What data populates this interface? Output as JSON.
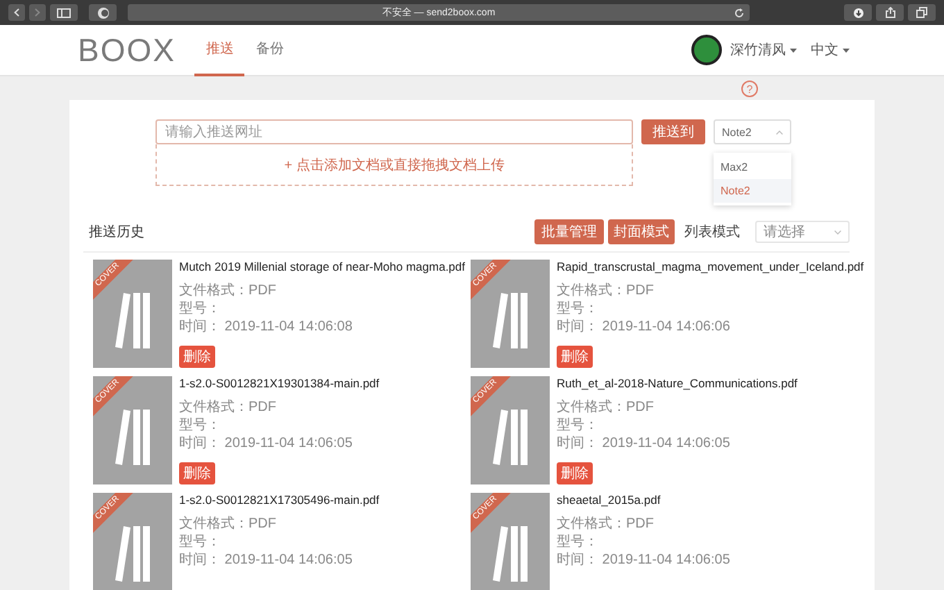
{
  "browser": {
    "address": "不安全 — send2boox.com"
  },
  "header": {
    "logo": "BOOX",
    "tabs": [
      {
        "label": "推送",
        "selected": true
      },
      {
        "label": "备份",
        "selected": false
      }
    ],
    "user": "深竹清风",
    "language": "中文"
  },
  "help": "?",
  "push": {
    "placeholder": "请输入推送网址",
    "button": "推送到",
    "device": "Note2",
    "options": [
      {
        "label": "Max2",
        "selected": false
      },
      {
        "label": "Note2",
        "selected": true
      }
    ],
    "upload": "+ 点击添加文档或直接拖拽文档上传"
  },
  "history": {
    "title": "推送历史",
    "batch": "批量管理",
    "modes": [
      {
        "label": "封面模式",
        "selected": true
      },
      {
        "label": "列表模式",
        "selected": false
      }
    ],
    "sort_placeholder": "请选择",
    "items": [
      {
        "cover": "COVER",
        "name": "Mutch 2019 Millenial storage of near-Moho magma.pdf",
        "format_label": "文件格式：",
        "format": "PDF",
        "model_label": "型号：",
        "time_label": "时间：",
        "time": "2019-11-04 14:06:08",
        "delete": "删除"
      },
      {
        "cover": "COVER",
        "name": "Rapid_transcrustal_magma_movement_under_Iceland.pdf",
        "format_label": "文件格式：",
        "format": "PDF",
        "model_label": "型号：",
        "time_label": "时间：",
        "time": "2019-11-04 14:06:06",
        "delete": "删除"
      },
      {
        "cover": "COVER",
        "name": "1-s2.0-S0012821X19301384-main.pdf",
        "format_label": "文件格式：",
        "format": "PDF",
        "model_label": "型号：",
        "time_label": "时间：",
        "time": "2019-11-04 14:06:05",
        "delete": "删除"
      },
      {
        "cover": "COVER",
        "name": "Ruth_et_al-2018-Nature_Communications.pdf",
        "format_label": "文件格式：",
        "format": "PDF",
        "model_label": "型号：",
        "time_label": "时间：",
        "time": "2019-11-04 14:06:05",
        "delete": "删除"
      },
      {
        "cover": "COVER",
        "name": "1-s2.0-S0012821X17305496-main.pdf",
        "format_label": "文件格式：",
        "format": "PDF",
        "model_label": "型号：",
        "time_label": "时间：",
        "time": "2019-11-04 14:06:05"
      },
      {
        "cover": "COVER",
        "name": "sheaetal_2015a.pdf",
        "format_label": "文件格式：",
        "format": "PDF",
        "model_label": "型号：",
        "time_label": "时间：",
        "time": "2019-11-04 14:06:05"
      }
    ]
  }
}
